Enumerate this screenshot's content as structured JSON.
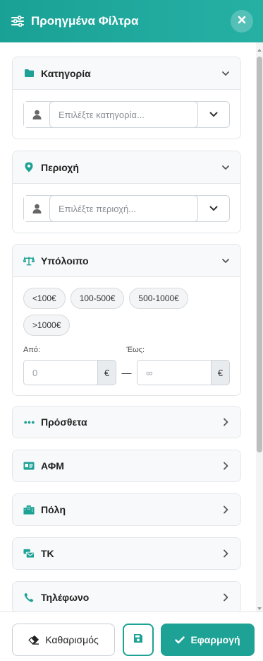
{
  "header": {
    "title": "Προηγμένα Φίλτρα",
    "icon": "sliders-icon",
    "close_icon": "close-icon"
  },
  "colors": {
    "accent": "#1ea295",
    "header_gradient_start": "#1aa196",
    "header_gradient_end": "#26b0a4",
    "section_bg": "#f8f9fa"
  },
  "sections": {
    "category": {
      "title": "Κατηγορία",
      "icon": "folder-icon",
      "placeholder": "Επιλέξτε κατηγορία...",
      "expanded": true
    },
    "region": {
      "title": "Περιοχή",
      "icon": "map-pin-icon",
      "placeholder": "Επιλέξτε περιοχή...",
      "expanded": true
    },
    "balance": {
      "title": "Υπόλοιπο",
      "icon": "balance-scale-icon",
      "expanded": true,
      "chips": [
        "<100€",
        "100-500€",
        "500-1000€",
        ">1000€"
      ],
      "from_label": "Από:",
      "to_label": "Έως:",
      "from_placeholder": "0",
      "to_placeholder": "∞",
      "currency": "€",
      "dash": "—"
    },
    "extra": {
      "title": "Πρόσθετα",
      "icon": "ellipsis-icon",
      "expanded": false
    },
    "afm": {
      "title": "ΑΦΜ",
      "icon": "id-card-icon",
      "expanded": false
    },
    "city": {
      "title": "Πόλη",
      "icon": "city-icon",
      "expanded": false
    },
    "tk": {
      "title": "ΤΚ",
      "icon": "mail-bulk-icon",
      "expanded": false
    },
    "phone": {
      "title": "Τηλέφωνο",
      "icon": "phone-icon",
      "expanded": false
    }
  },
  "footer": {
    "clear_label": "Καθαρισμός",
    "save_icon": "save-icon",
    "apply_label": "Εφαρμογή"
  }
}
